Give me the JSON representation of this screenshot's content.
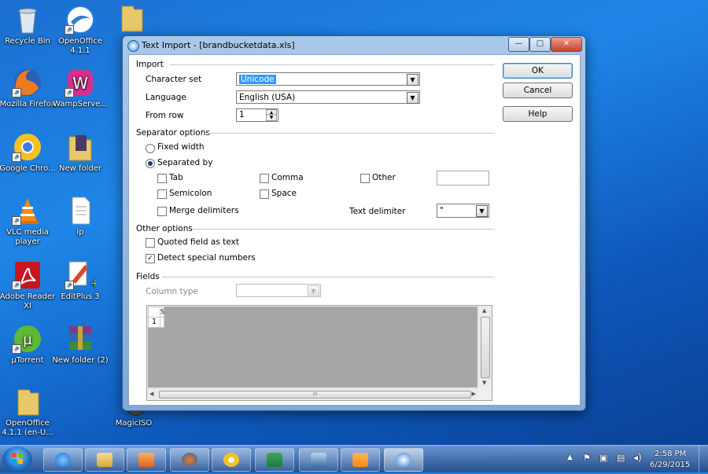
{
  "desktop": {
    "icons": [
      {
        "label": "Recycle Bin"
      },
      {
        "label": "OpenOffice 4.1.1"
      },
      {
        "label": "Mozilla Firefox"
      },
      {
        "label": "WampServe..."
      },
      {
        "label": "Google Chro..."
      },
      {
        "label": "New folder"
      },
      {
        "label": "VLC media player"
      },
      {
        "label": "ip"
      },
      {
        "label": "Adobe Reader XI"
      },
      {
        "label": "EditPlus 3"
      },
      {
        "label": "µTorrent"
      },
      {
        "label": "New folder (2)"
      },
      {
        "label": "OpenOffice 4.1.1 (en-U..."
      },
      {
        "label": "MagicISO"
      }
    ]
  },
  "dialog": {
    "title": "Text Import - [brandbucketdata.xls]",
    "import_section": "Import",
    "character_set_label": "Character set",
    "character_set_value": "Unicode",
    "language_label": "Language",
    "language_value": "English (USA)",
    "from_row_label": "From row",
    "from_row_value": "1",
    "separator_section": "Separator options",
    "fixed_width_label": "Fixed width",
    "separated_by_label": "Separated by",
    "tab_label": "Tab",
    "comma_label": "Comma",
    "other_label": "Other",
    "semicolon_label": "Semicolon",
    "space_label": "Space",
    "merge_delimiters_label": "Merge delimiters",
    "text_delimiter_label": "Text delimiter",
    "text_delimiter_value": "\"",
    "other_options_section": "Other options",
    "quoted_field_label": "Quoted field as text",
    "detect_special_label": "Detect special numbers",
    "fields_section": "Fields",
    "column_type_label": "Column type",
    "column_type_value": "",
    "grid_col_header": "S",
    "grid_row_header": "1",
    "hscroll_grip": "III",
    "ok_label": "OK",
    "cancel_label": "Cancel",
    "help_label": "Help",
    "minimize_glyph": "—",
    "maximize_glyph": "□",
    "close_glyph": "✕",
    "checked_glyph": "✓",
    "state": {
      "fixed_width": false,
      "separated_by": true,
      "tab": false,
      "comma": false,
      "other": false,
      "semicolon": false,
      "space": false,
      "merge_delimiters": false,
      "quoted_field_as_text": false,
      "detect_special_numbers": true
    }
  },
  "tray": {
    "time": "2:58 PM",
    "date": "6/29/2015"
  },
  "icons": [
    "start-orb",
    "internet-explorer-icon",
    "explorer-icon",
    "media-player-icon",
    "firefox-icon",
    "chrome-icon",
    "excel-icon",
    "remote-desktop-icon",
    "vlc-icon",
    "openoffice-icon"
  ]
}
